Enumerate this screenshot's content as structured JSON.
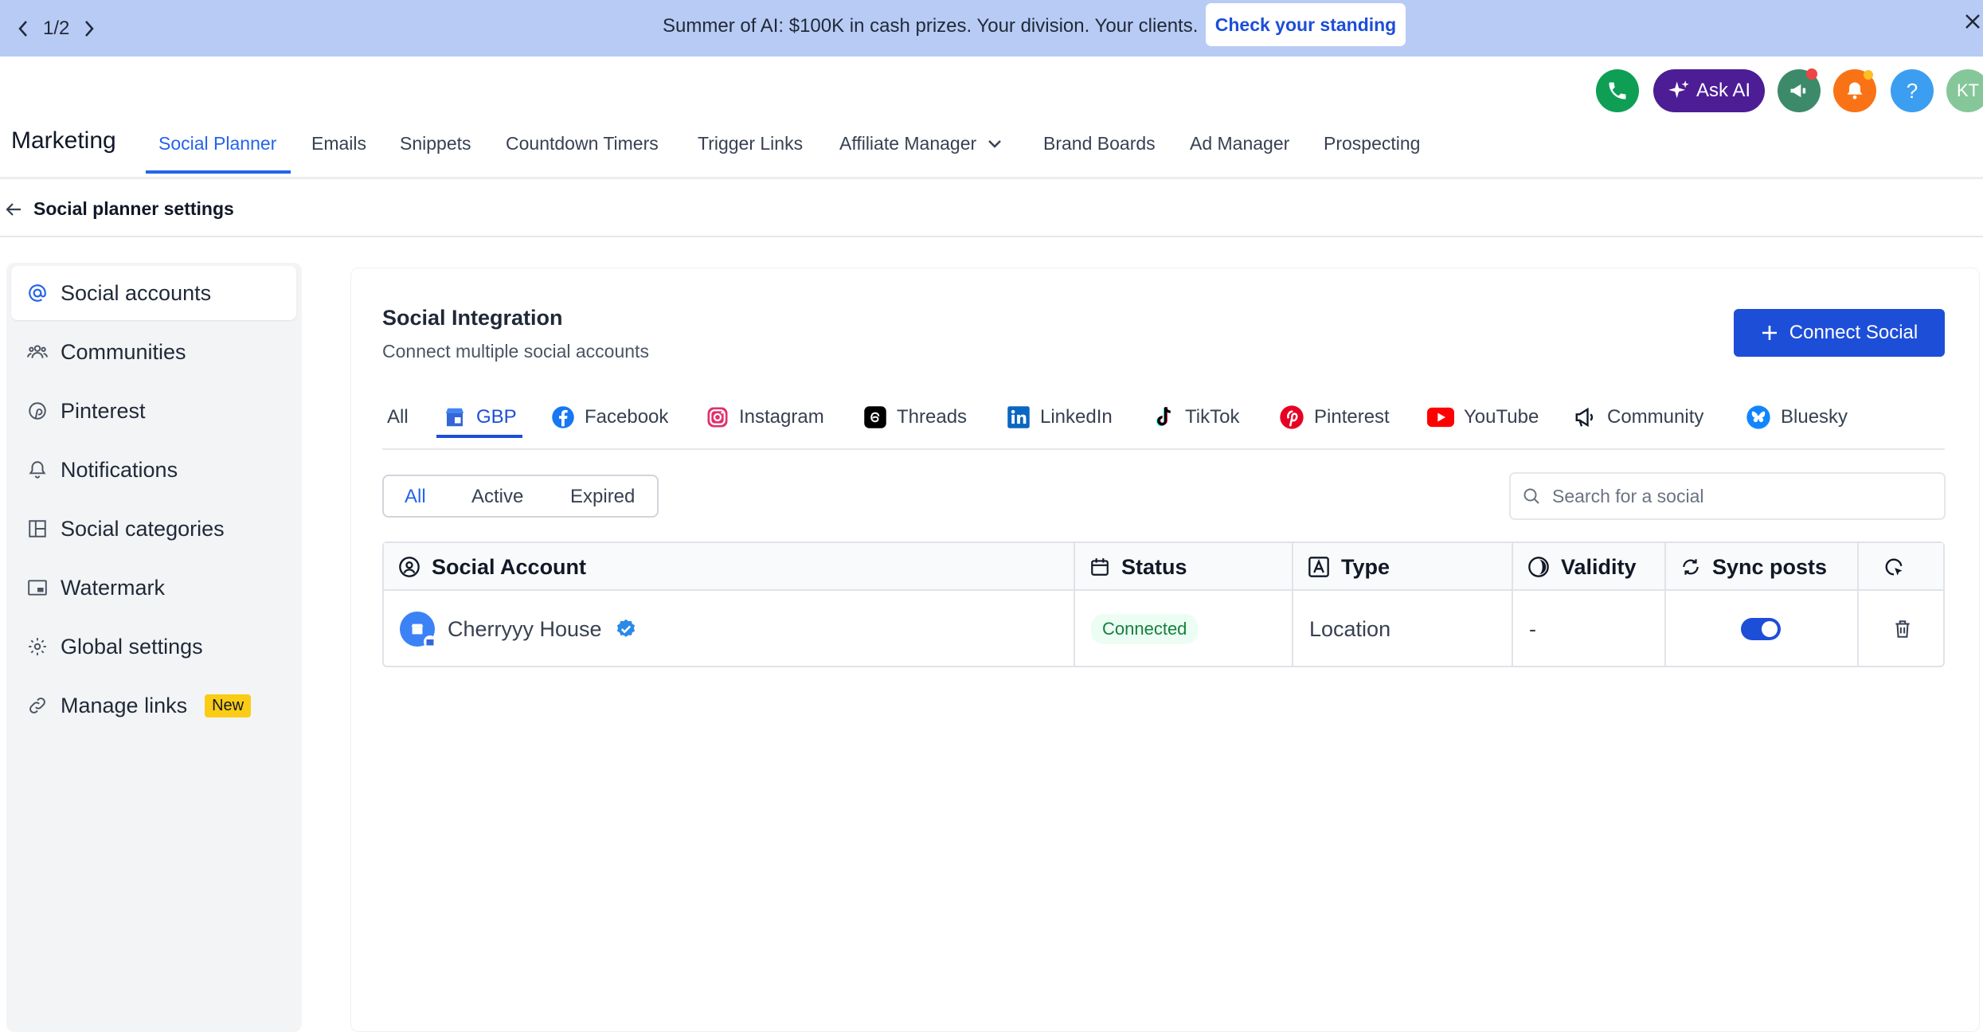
{
  "announcement": {
    "pager": "1/2",
    "text": "Summer of AI: $100K in cash prizes. Your division. Your clients.",
    "cta": "Check your standing"
  },
  "top_actions": {
    "ask_ai": "Ask AI",
    "help": "?",
    "avatar_initials": "KT"
  },
  "nav": {
    "brand": "Marketing",
    "items": [
      "Social Planner",
      "Emails",
      "Snippets",
      "Countdown Timers",
      "Trigger Links",
      "Affiliate Manager",
      "Brand Boards",
      "Ad Manager",
      "Prospecting"
    ]
  },
  "subheader": {
    "title": "Social planner settings"
  },
  "sidebar": {
    "items": [
      {
        "label": "Social accounts",
        "icon": "at-icon"
      },
      {
        "label": "Communities",
        "icon": "users-icon"
      },
      {
        "label": "Pinterest",
        "icon": "pinterest-icon"
      },
      {
        "label": "Notifications",
        "icon": "bell-icon"
      },
      {
        "label": "Social categories",
        "icon": "layout-icon"
      },
      {
        "label": "Watermark",
        "icon": "watermark-icon"
      },
      {
        "label": "Global settings",
        "icon": "gear-icon"
      },
      {
        "label": "Manage links",
        "icon": "link-icon",
        "badge": "New"
      }
    ]
  },
  "main": {
    "title": "Social Integration",
    "subtitle": "Connect multiple social accounts",
    "connect_button": "Connect Social",
    "platform_tabs": [
      "All",
      "GBP",
      "Facebook",
      "Instagram",
      "Threads",
      "LinkedIn",
      "TikTok",
      "Pinterest",
      "YouTube",
      "Community",
      "Bluesky"
    ],
    "filter_tabs": [
      "All",
      "Active",
      "Expired"
    ],
    "search_placeholder": "Search for a social"
  },
  "table": {
    "headers": [
      "Social Account",
      "Status",
      "Type",
      "Validity",
      "Sync posts"
    ],
    "rows": [
      {
        "account": "Cherryyy House",
        "status": "Connected",
        "type": "Location",
        "validity": "-",
        "sync": true
      }
    ]
  },
  "colors": {
    "accent": "#1d4ed8",
    "banner": "#b8cbf5",
    "badge_new": "#facc15",
    "connected_text": "#15803d"
  }
}
